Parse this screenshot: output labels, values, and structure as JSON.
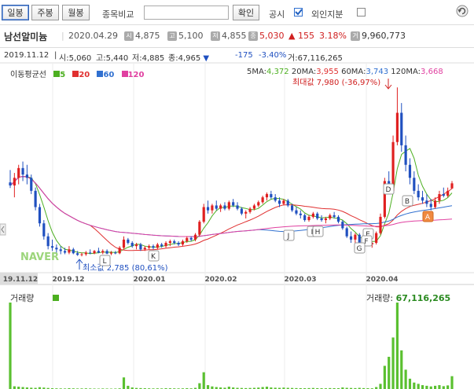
{
  "toolbar": {
    "periods": [
      "일봉",
      "주봉",
      "월봉"
    ],
    "compare_label": "종목비교",
    "confirm_label": "확인",
    "disclosure_label": "공시",
    "foreign_label": "외인지분"
  },
  "stock": {
    "name": "남선알미늄",
    "date": "2020.04.29",
    "open": "4,875",
    "high": "5,100",
    "low": "4,855",
    "close": "5,030",
    "change": "155",
    "change_pct": "3.18%",
    "volume": "9,960,773",
    "badges": {
      "open": "시",
      "high": "고",
      "low": "저",
      "close": "종",
      "volume": "거"
    }
  },
  "ohlc_bar": {
    "date": "2019.11.12",
    "open_label": "시:",
    "open": "5,060",
    "high_label": "고:",
    "high": "5,440",
    "low_label": "저:",
    "low": "4,885",
    "close_label": "종:",
    "close": "4,965",
    "change": "-175",
    "change_pct": "-3.40%",
    "volume_label": "거:",
    "volume": "67,116,265"
  },
  "legend": {
    "label": "이동평균선",
    "items": [
      {
        "name": "5",
        "color": "#4caf20"
      },
      {
        "name": "20",
        "color": "#e03030"
      },
      {
        "name": "60",
        "color": "#3070d0"
      },
      {
        "name": "120",
        "color": "#e040a0"
      }
    ]
  },
  "ma_values": {
    "ma5_label": "5MA:",
    "ma5": "4,372",
    "ma20_label": "20MA:",
    "ma20": "3,955",
    "ma60_label": "60MA:",
    "ma60": "3,743",
    "ma120_label": "120MA:",
    "ma120": "3,668"
  },
  "annotations": {
    "max": "최대값 7,980 (-36,97%)",
    "min": "최소값 2,785 (80,61%)",
    "watermark": "NAVER",
    "markers": [
      "D",
      "B",
      "A",
      "J",
      "I",
      "H",
      "E",
      "F",
      "G",
      "L",
      "K"
    ]
  },
  "volume_panel": {
    "label": "거래량",
    "right_label": "거래량:",
    "right_value": "67,116,265"
  },
  "chart_data": {
    "type": "candlestick",
    "x_tick_labels": [
      "19.11.12",
      "2019.12",
      "2020.01",
      "2020.02",
      "2020.03",
      "2020.04"
    ],
    "y_range": [
      2500,
      8300
    ],
    "candles": [
      [
        5060,
        5440,
        4885,
        4965
      ],
      [
        4965,
        5350,
        4600,
        5200
      ],
      [
        5200,
        5600,
        5000,
        5500
      ],
      [
        5500,
        5700,
        5100,
        5300
      ],
      [
        5300,
        5600,
        5000,
        5200
      ],
      [
        5200,
        5300,
        4700,
        4800
      ],
      [
        4800,
        4900,
        4200,
        4300
      ],
      [
        4300,
        4400,
        3700,
        3800
      ],
      [
        3800,
        3900,
        3300,
        3400
      ],
      [
        3400,
        3500,
        3000,
        3100
      ],
      [
        3100,
        3300,
        2950,
        3050
      ],
      [
        3050,
        3150,
        2900,
        3000
      ],
      [
        3000,
        3100,
        2850,
        2950
      ],
      [
        2950,
        3050,
        2850,
        2900
      ],
      [
        2900,
        3100,
        2850,
        3000
      ],
      [
        3000,
        3050,
        2850,
        2880
      ],
      [
        2880,
        2950,
        2800,
        2830
      ],
      [
        2830,
        2900,
        2785,
        2850
      ],
      [
        2850,
        2950,
        2800,
        2900
      ],
      [
        2900,
        3000,
        2850,
        2880
      ],
      [
        2880,
        2980,
        2850,
        2950
      ],
      [
        2950,
        3050,
        2880,
        2900
      ],
      [
        2900,
        3000,
        2850,
        2950
      ],
      [
        2950,
        3000,
        2850,
        2870
      ],
      [
        2870,
        2950,
        2820,
        2900
      ],
      [
        2900,
        2950,
        2850,
        2880
      ],
      [
        2880,
        3100,
        2850,
        3050
      ],
      [
        3050,
        3400,
        3000,
        3300
      ],
      [
        3300,
        3350,
        3150,
        3200
      ],
      [
        3200,
        3250,
        3050,
        3100
      ],
      [
        3100,
        3200,
        3000,
        3150
      ],
      [
        3150,
        3200,
        2950,
        3000
      ],
      [
        3000,
        3100,
        2950,
        3050
      ],
      [
        3050,
        3150,
        3000,
        3100
      ],
      [
        3100,
        3150,
        3000,
        3050
      ],
      [
        3050,
        3200,
        3000,
        3150
      ],
      [
        3150,
        3200,
        3050,
        3100
      ],
      [
        3100,
        3250,
        3050,
        3200
      ],
      [
        3200,
        3300,
        3100,
        3250
      ],
      [
        3250,
        3300,
        3150,
        3200
      ],
      [
        3200,
        3250,
        3100,
        3150
      ],
      [
        3150,
        3300,
        3100,
        3250
      ],
      [
        3250,
        3400,
        3200,
        3350
      ],
      [
        3350,
        3400,
        3250,
        3300
      ],
      [
        3300,
        3500,
        3250,
        3450
      ],
      [
        3450,
        3900,
        3400,
        3850
      ],
      [
        3850,
        4400,
        3800,
        4300
      ],
      [
        4300,
        4500,
        4100,
        4200
      ],
      [
        4200,
        4400,
        4100,
        4350
      ],
      [
        4350,
        4500,
        4200,
        4250
      ],
      [
        4250,
        4400,
        4150,
        4350
      ],
      [
        4350,
        4450,
        4200,
        4250
      ],
      [
        4250,
        4500,
        4200,
        4450
      ],
      [
        4450,
        4550,
        4300,
        4350
      ],
      [
        4350,
        4450,
        4200,
        4250
      ],
      [
        4250,
        4300,
        4050,
        4100
      ],
      [
        4100,
        4200,
        3950,
        4150
      ],
      [
        4150,
        4300,
        4100,
        4250
      ],
      [
        4250,
        4400,
        4200,
        4350
      ],
      [
        4350,
        4500,
        4300,
        4450
      ],
      [
        4450,
        4650,
        4400,
        4600
      ],
      [
        4600,
        4750,
        4500,
        4700
      ],
      [
        4700,
        4800,
        4550,
        4600
      ],
      [
        4600,
        4700,
        4450,
        4500
      ],
      [
        4500,
        4600,
        4300,
        4400
      ],
      [
        4400,
        4550,
        4350,
        4500
      ],
      [
        4500,
        4550,
        4300,
        4350
      ],
      [
        4350,
        4400,
        4150,
        4200
      ],
      [
        4200,
        4300,
        4050,
        4100
      ],
      [
        4100,
        4200,
        3950,
        4050
      ],
      [
        4050,
        4100,
        3850,
        3900
      ],
      [
        3900,
        4050,
        3850,
        4000
      ],
      [
        4000,
        4150,
        3950,
        4100
      ],
      [
        4100,
        4150,
        3900,
        3950
      ],
      [
        3950,
        4050,
        3850,
        3900
      ],
      [
        3900,
        4000,
        3800,
        3950
      ],
      [
        3950,
        4100,
        3900,
        4050
      ],
      [
        4050,
        4150,
        3950,
        4000
      ],
      [
        4000,
        4050,
        3800,
        3850
      ],
      [
        3850,
        3900,
        3600,
        3650
      ],
      [
        3650,
        3700,
        3350,
        3400
      ],
      [
        3400,
        3550,
        3200,
        3300
      ],
      [
        3300,
        3500,
        3150,
        3450
      ],
      [
        3450,
        3500,
        3100,
        3150
      ],
      [
        3150,
        3300,
        3050,
        3250
      ],
      [
        3250,
        3350,
        3100,
        3150
      ],
      [
        3150,
        3250,
        3050,
        3200
      ],
      [
        3200,
        3550,
        3150,
        3500
      ],
      [
        3500,
        4100,
        3450,
        4000
      ],
      [
        4000,
        5200,
        3950,
        5100
      ],
      [
        5100,
        5400,
        4700,
        4800
      ],
      [
        4800,
        6500,
        4750,
        6300
      ],
      [
        6300,
        7980,
        6200,
        7200
      ],
      [
        7200,
        7500,
        6000,
        6200
      ],
      [
        6200,
        6500,
        5400,
        5600
      ],
      [
        5600,
        5800,
        5000,
        5200
      ],
      [
        5200,
        5400,
        4700,
        4800
      ],
      [
        4800,
        5000,
        4500,
        4600
      ],
      [
        4600,
        4800,
        4400,
        4500
      ],
      [
        4500,
        4700,
        4300,
        4400
      ],
      [
        4400,
        4550,
        4200,
        4300
      ],
      [
        4300,
        4600,
        4250,
        4500
      ],
      [
        4500,
        4800,
        4400,
        4700
      ],
      [
        4700,
        4900,
        4600,
        4650
      ],
      [
        4650,
        4900,
        4600,
        4800
      ],
      [
        4875,
        5100,
        4855,
        5030
      ]
    ],
    "volume": [
      67116265,
      2100000,
      1800000,
      1500000,
      1200000,
      1000000,
      900000,
      1400000,
      1100000,
      800000,
      600000,
      500000,
      450000,
      400000,
      600000,
      500000,
      400000,
      450000,
      500000,
      400000,
      350000,
      300000,
      400000,
      350000,
      300000,
      350000,
      500000,
      9000000,
      2500000,
      1200000,
      800000,
      700000,
      600000,
      500000,
      450000,
      500000,
      450000,
      600000,
      550000,
      500000,
      450000,
      500000,
      600000,
      500000,
      900000,
      4500000,
      13000000,
      3000000,
      2000000,
      1500000,
      1200000,
      1000000,
      1800000,
      1200000,
      900000,
      800000,
      700000,
      800000,
      900000,
      1100000,
      1500000,
      1800000,
      1200000,
      1000000,
      900000,
      1100000,
      900000,
      800000,
      700000,
      650000,
      600000,
      700000,
      800000,
      650000,
      600000,
      550000,
      700000,
      650000,
      600000,
      1200000,
      900000,
      800000,
      700000,
      900000,
      700000,
      600000,
      550000,
      1500000,
      4000000,
      18000000,
      25000000,
      40000000,
      67116265,
      30000000,
      15000000,
      8000000,
      5000000,
      4000000,
      3000000,
      2500000,
      2000000,
      2500000,
      3000000,
      2200000,
      2800000,
      9960773
    ],
    "series": [
      {
        "name": "5"
      },
      {
        "name": "20"
      },
      {
        "name": "60"
      },
      {
        "name": "120"
      }
    ]
  }
}
